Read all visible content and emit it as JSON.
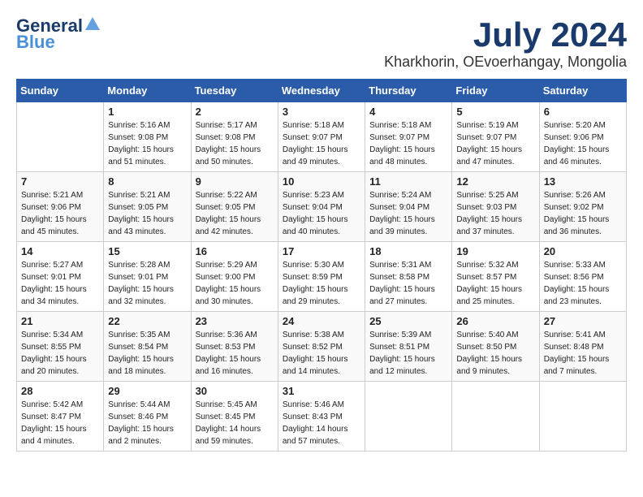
{
  "header": {
    "logo_general": "General",
    "logo_blue": "Blue",
    "month_year": "July 2024",
    "location": "Kharkhorin, OEvoerhangay, Mongolia"
  },
  "days_of_week": [
    "Sunday",
    "Monday",
    "Tuesday",
    "Wednesday",
    "Thursday",
    "Friday",
    "Saturday"
  ],
  "weeks": [
    [
      {
        "day": "",
        "info": ""
      },
      {
        "day": "1",
        "info": "Sunrise: 5:16 AM\nSunset: 9:08 PM\nDaylight: 15 hours\nand 51 minutes."
      },
      {
        "day": "2",
        "info": "Sunrise: 5:17 AM\nSunset: 9:08 PM\nDaylight: 15 hours\nand 50 minutes."
      },
      {
        "day": "3",
        "info": "Sunrise: 5:18 AM\nSunset: 9:07 PM\nDaylight: 15 hours\nand 49 minutes."
      },
      {
        "day": "4",
        "info": "Sunrise: 5:18 AM\nSunset: 9:07 PM\nDaylight: 15 hours\nand 48 minutes."
      },
      {
        "day": "5",
        "info": "Sunrise: 5:19 AM\nSunset: 9:07 PM\nDaylight: 15 hours\nand 47 minutes."
      },
      {
        "day": "6",
        "info": "Sunrise: 5:20 AM\nSunset: 9:06 PM\nDaylight: 15 hours\nand 46 minutes."
      }
    ],
    [
      {
        "day": "7",
        "info": "Sunrise: 5:21 AM\nSunset: 9:06 PM\nDaylight: 15 hours\nand 45 minutes."
      },
      {
        "day": "8",
        "info": "Sunrise: 5:21 AM\nSunset: 9:05 PM\nDaylight: 15 hours\nand 43 minutes."
      },
      {
        "day": "9",
        "info": "Sunrise: 5:22 AM\nSunset: 9:05 PM\nDaylight: 15 hours\nand 42 minutes."
      },
      {
        "day": "10",
        "info": "Sunrise: 5:23 AM\nSunset: 9:04 PM\nDaylight: 15 hours\nand 40 minutes."
      },
      {
        "day": "11",
        "info": "Sunrise: 5:24 AM\nSunset: 9:04 PM\nDaylight: 15 hours\nand 39 minutes."
      },
      {
        "day": "12",
        "info": "Sunrise: 5:25 AM\nSunset: 9:03 PM\nDaylight: 15 hours\nand 37 minutes."
      },
      {
        "day": "13",
        "info": "Sunrise: 5:26 AM\nSunset: 9:02 PM\nDaylight: 15 hours\nand 36 minutes."
      }
    ],
    [
      {
        "day": "14",
        "info": "Sunrise: 5:27 AM\nSunset: 9:01 PM\nDaylight: 15 hours\nand 34 minutes."
      },
      {
        "day": "15",
        "info": "Sunrise: 5:28 AM\nSunset: 9:01 PM\nDaylight: 15 hours\nand 32 minutes."
      },
      {
        "day": "16",
        "info": "Sunrise: 5:29 AM\nSunset: 9:00 PM\nDaylight: 15 hours\nand 30 minutes."
      },
      {
        "day": "17",
        "info": "Sunrise: 5:30 AM\nSunset: 8:59 PM\nDaylight: 15 hours\nand 29 minutes."
      },
      {
        "day": "18",
        "info": "Sunrise: 5:31 AM\nSunset: 8:58 PM\nDaylight: 15 hours\nand 27 minutes."
      },
      {
        "day": "19",
        "info": "Sunrise: 5:32 AM\nSunset: 8:57 PM\nDaylight: 15 hours\nand 25 minutes."
      },
      {
        "day": "20",
        "info": "Sunrise: 5:33 AM\nSunset: 8:56 PM\nDaylight: 15 hours\nand 23 minutes."
      }
    ],
    [
      {
        "day": "21",
        "info": "Sunrise: 5:34 AM\nSunset: 8:55 PM\nDaylight: 15 hours\nand 20 minutes."
      },
      {
        "day": "22",
        "info": "Sunrise: 5:35 AM\nSunset: 8:54 PM\nDaylight: 15 hours\nand 18 minutes."
      },
      {
        "day": "23",
        "info": "Sunrise: 5:36 AM\nSunset: 8:53 PM\nDaylight: 15 hours\nand 16 minutes."
      },
      {
        "day": "24",
        "info": "Sunrise: 5:38 AM\nSunset: 8:52 PM\nDaylight: 15 hours\nand 14 minutes."
      },
      {
        "day": "25",
        "info": "Sunrise: 5:39 AM\nSunset: 8:51 PM\nDaylight: 15 hours\nand 12 minutes."
      },
      {
        "day": "26",
        "info": "Sunrise: 5:40 AM\nSunset: 8:50 PM\nDaylight: 15 hours\nand 9 minutes."
      },
      {
        "day": "27",
        "info": "Sunrise: 5:41 AM\nSunset: 8:48 PM\nDaylight: 15 hours\nand 7 minutes."
      }
    ],
    [
      {
        "day": "28",
        "info": "Sunrise: 5:42 AM\nSunset: 8:47 PM\nDaylight: 15 hours\nand 4 minutes."
      },
      {
        "day": "29",
        "info": "Sunrise: 5:44 AM\nSunset: 8:46 PM\nDaylight: 15 hours\nand 2 minutes."
      },
      {
        "day": "30",
        "info": "Sunrise: 5:45 AM\nSunset: 8:45 PM\nDaylight: 14 hours\nand 59 minutes."
      },
      {
        "day": "31",
        "info": "Sunrise: 5:46 AM\nSunset: 8:43 PM\nDaylight: 14 hours\nand 57 minutes."
      },
      {
        "day": "",
        "info": ""
      },
      {
        "day": "",
        "info": ""
      },
      {
        "day": "",
        "info": ""
      }
    ]
  ]
}
